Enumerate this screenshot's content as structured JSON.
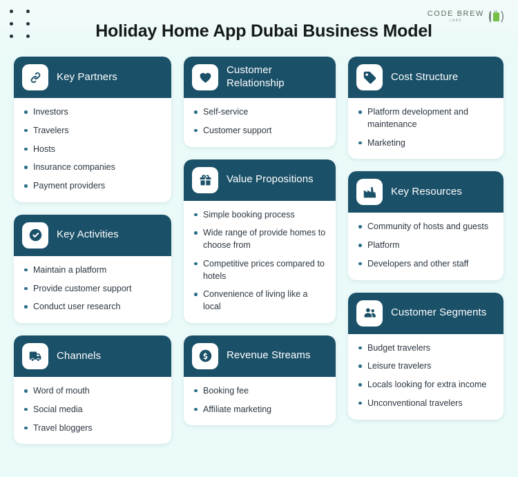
{
  "header": {
    "title": "Holiday Home App Dubai Business Model",
    "brand_name": "CODE BREW",
    "brand_sub": "LABS",
    "dots_icon": "dot-grid-decoration",
    "logo_icon": "code-brew-labs-logo"
  },
  "colors": {
    "page_background": "#eafaf9",
    "card_header": "#1a5068",
    "card_background": "#ffffff",
    "bullet": "#2a6e87",
    "body_text": "#2b3640",
    "title_text": "#15191c",
    "brand_green": "#74bf44"
  },
  "columns": [
    {
      "name": "left",
      "cards": [
        {
          "title": "Key Partners",
          "icon": "link-icon",
          "items": [
            "Investors",
            "Travelers",
            "Hosts",
            "Insurance companies",
            "Payment providers"
          ]
        },
        {
          "title": "Key Activities",
          "icon": "check-circle-icon",
          "items": [
            "Maintain a platform",
            "Provide customer support",
            "Conduct user research"
          ]
        },
        {
          "title": "Channels",
          "icon": "truck-icon",
          "items": [
            "Word of mouth",
            "Social media",
            "Travel bloggers"
          ]
        }
      ]
    },
    {
      "name": "middle",
      "cards": [
        {
          "title": "Customer Relationship",
          "icon": "heart-icon",
          "items": [
            "Self-service",
            "Customer support"
          ]
        },
        {
          "title": "Value Propositions",
          "icon": "gift-icon",
          "items": [
            "Simple booking process",
            "Wide range of provide homes to choose from",
            "Competitive prices compared to hotels",
            "Convenience of living like a local"
          ]
        },
        {
          "title": "Revenue Streams",
          "icon": "dollar-circle-icon",
          "items": [
            "Booking fee",
            "Affiliate marketing"
          ]
        }
      ]
    },
    {
      "name": "right",
      "cards": [
        {
          "title": "Cost Structure",
          "icon": "price-tag-icon",
          "items": [
            "Platform development and maintenance",
            "Marketing"
          ]
        },
        {
          "title": "Key Resources",
          "icon": "factory-icon",
          "items": [
            "Community of hosts and guests",
            "Platform",
            "Developers and other staff"
          ]
        },
        {
          "title": "Customer Segments",
          "icon": "people-icon",
          "items": [
            "Budget travelers",
            "Leisure travelers",
            "Locals looking for extra income",
            "Unconventional travelers"
          ]
        }
      ]
    }
  ]
}
